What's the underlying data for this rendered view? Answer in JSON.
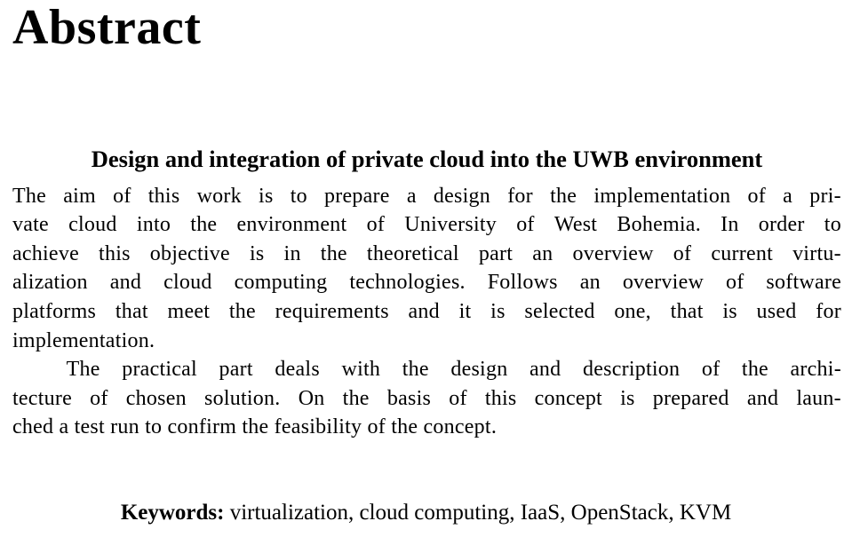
{
  "document": {
    "section_title": "Abstract",
    "subtitle": "Design and integration of private cloud into the UWB environment",
    "abstract_lines": [
      "The aim of this work is to prepare a design for the implementation of a pri-",
      "vate cloud into the environment of University of West Bohemia. In order to",
      "achieve this objective is in the theoretical part an overview of current virtu-",
      "alization and cloud computing technologies. Follows an overview of software",
      "platforms that meet the requirements and it is selected one, that is used for",
      "implementation.",
      "The practical part deals with the design and description of the archi-",
      "tecture of chosen solution. On the basis of this concept is prepared and laun-",
      "ched a test run to confirm the feasibility of the concept."
    ],
    "keywords": {
      "label": "Keywords:",
      "list": "virtualization, cloud computing, IaaS, OpenStack, KVM"
    },
    "colors": {
      "text": "#000000",
      "background": "#ffffff"
    }
  }
}
